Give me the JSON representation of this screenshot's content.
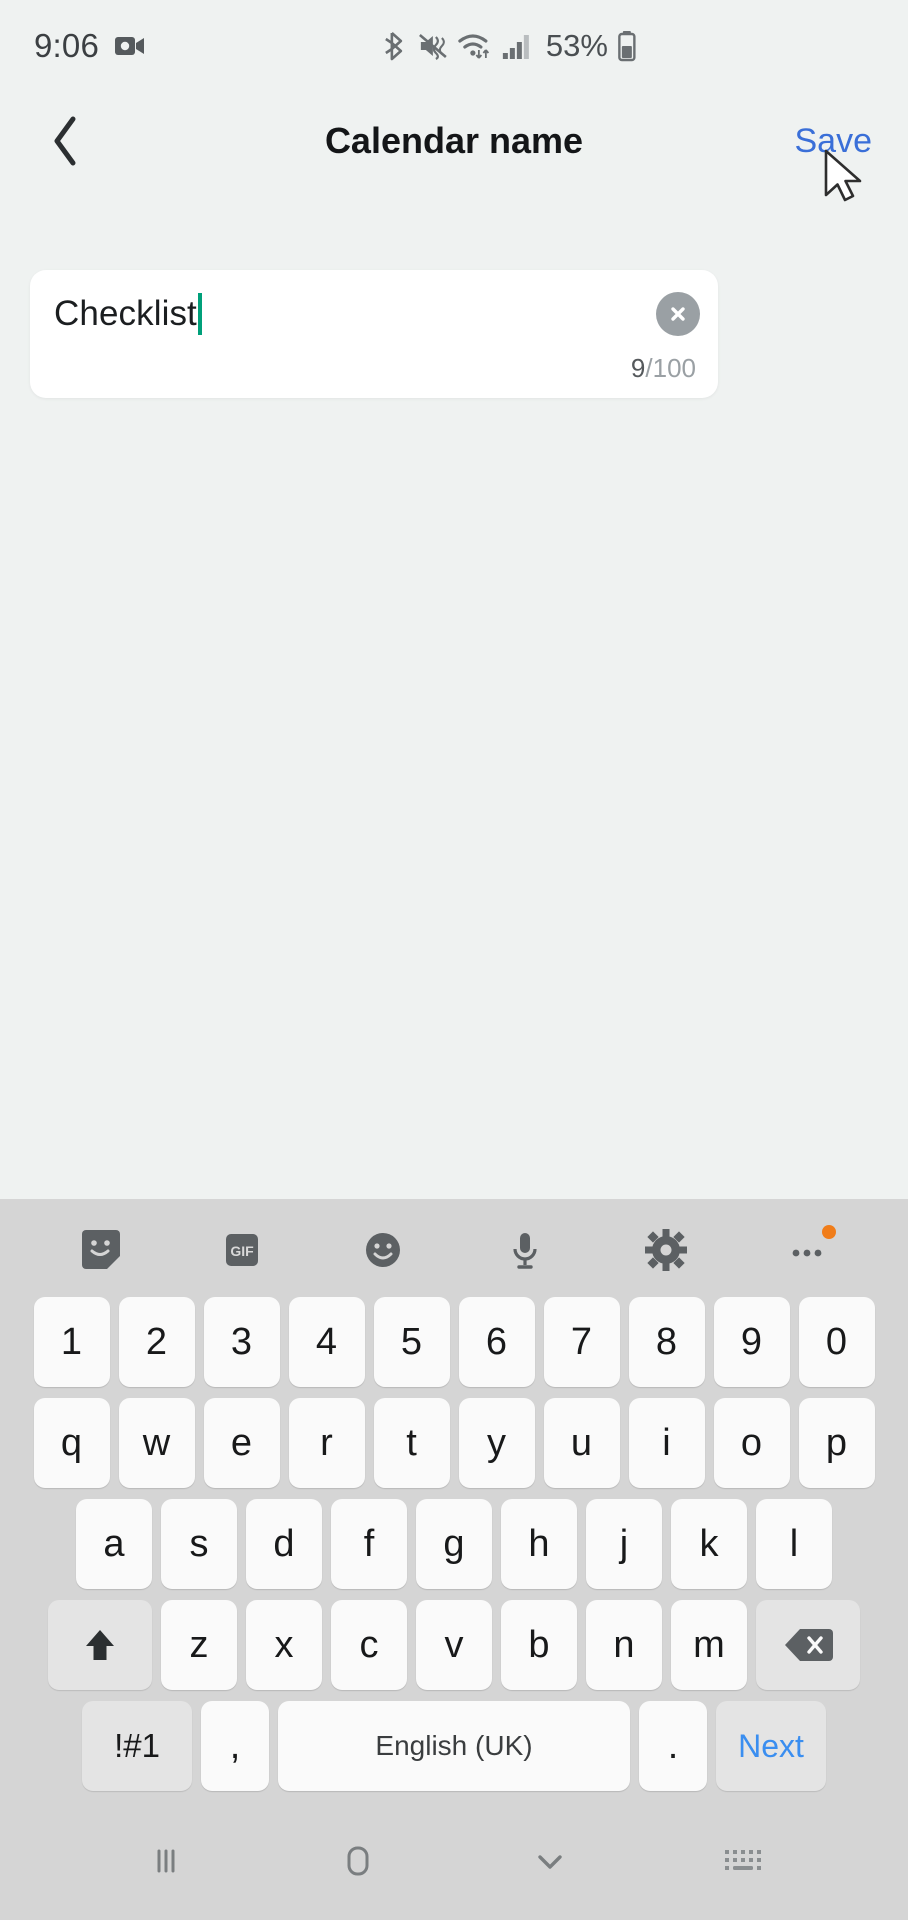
{
  "status_bar": {
    "clock": "9:06",
    "battery_percent": "53%",
    "icons": [
      "video-recorder-icon",
      "bluetooth-icon",
      "mute-vibrate-icon",
      "wifi-icon",
      "cellular-signal-icon",
      "battery-icon"
    ]
  },
  "app_bar": {
    "back_label": "back-chevron-icon",
    "title": "Calendar name",
    "save_label": "Save",
    "save_color": "#3a6fd8"
  },
  "field": {
    "value": "Checklist",
    "placeholder": "Calendar name",
    "clear_label": "clear-text-icon",
    "counter_current": "9",
    "counter_total": "/100",
    "caret_color": "#00a07a"
  },
  "keyboard": {
    "toolbar": [
      {
        "name": "sticker-icon",
        "label": ""
      },
      {
        "name": "gif-icon",
        "label": "GIF"
      },
      {
        "name": "emoji-icon",
        "label": ""
      },
      {
        "name": "microphone-icon",
        "label": ""
      },
      {
        "name": "keyboard-settings-icon",
        "label": ""
      },
      {
        "name": "more-options-icon",
        "label": ""
      }
    ],
    "row_numbers": [
      "1",
      "2",
      "3",
      "4",
      "5",
      "6",
      "7",
      "8",
      "9",
      "0"
    ],
    "row_top": [
      "q",
      "w",
      "e",
      "r",
      "t",
      "y",
      "u",
      "i",
      "o",
      "p"
    ],
    "row_home": [
      "a",
      "s",
      "d",
      "f",
      "g",
      "h",
      "j",
      "k",
      "l"
    ],
    "row_bottom": [
      "z",
      "x",
      "c",
      "v",
      "b",
      "n",
      "m"
    ],
    "shift_label": "shift-arrow-icon",
    "backspace_label": "backspace-icon",
    "symbols_label": "!#1",
    "comma_label": ",",
    "space_label": "English (UK)",
    "period_label": ".",
    "next_label": "Next",
    "next_color": "#3a8ef0"
  },
  "nav_bar": {
    "recents_label": "recent-apps-icon",
    "home_label": "home-icon",
    "back_label": "dismiss-keyboard-chevron-icon",
    "keyboard_toggle_label": "keyboard-toggle-icon"
  },
  "theme": {
    "content_bg": "#eff2f1",
    "keyboard_bg": "#d5d5d5",
    "key_bg": "#fafafa",
    "fn_key_bg": "#e4e4e4",
    "card_bg": "#ffffff"
  }
}
